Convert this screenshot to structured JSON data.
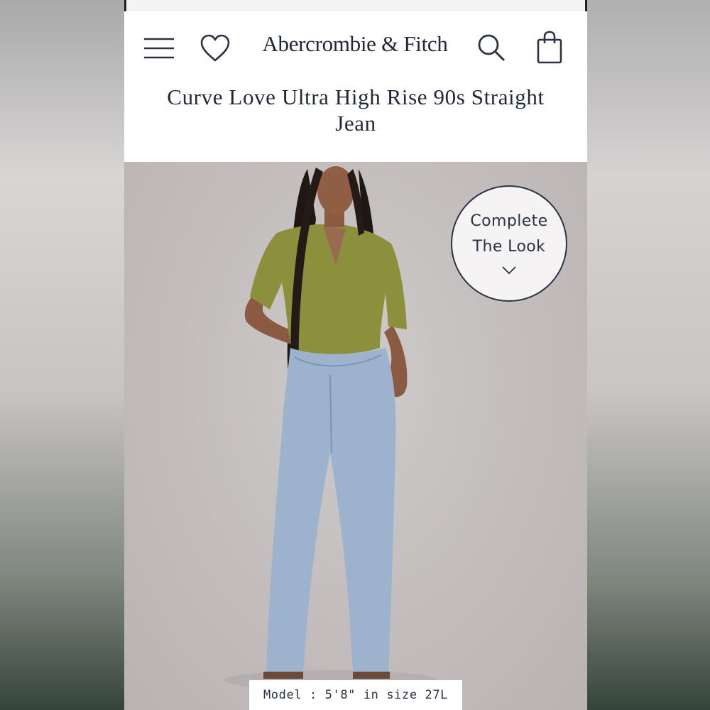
{
  "header": {
    "brand": "Abercrombie & Fitch",
    "menu_icon": "hamburger-menu-icon",
    "wishlist_icon": "heart-icon",
    "search_icon": "search-icon",
    "bag_icon": "shopping-bag-icon"
  },
  "product": {
    "title": "Curve Love Ultra High Rise 90s Straight Jean"
  },
  "complete_look": {
    "line1": "Complete",
    "line2": "The Look",
    "icon": "chevron-down-icon"
  },
  "photo": {
    "model_caption": "Model : 5'8\" in size 27L"
  },
  "colors": {
    "brand_navy": "#20283a",
    "background": "#ffffff",
    "photo_backdrop": "#c4bebe"
  }
}
